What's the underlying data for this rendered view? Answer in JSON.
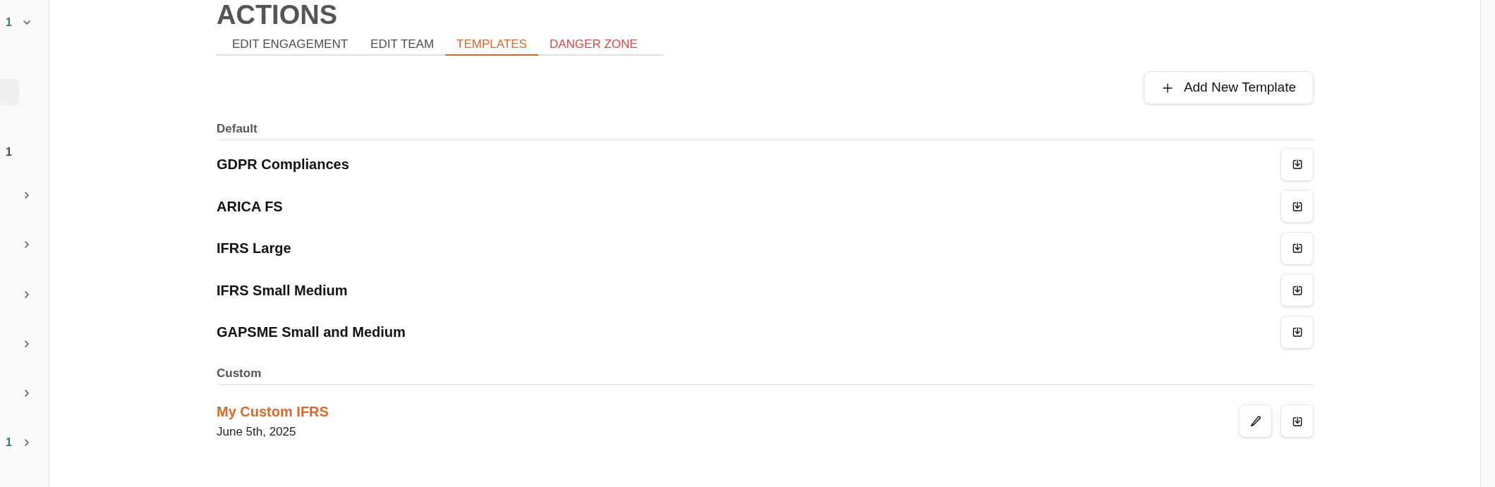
{
  "sidebar": {
    "items": [
      {
        "count": "1",
        "color": "#2b7b78",
        "expanded": true,
        "selected": false
      },
      {
        "selected": true
      },
      {
        "count": "1",
        "color": "#4a4a4a",
        "selected": false
      },
      {
        "expanded": false,
        "selected": false
      },
      {
        "expanded": false,
        "selected": false
      },
      {
        "expanded": false,
        "selected": false
      },
      {
        "expanded": false,
        "selected": false
      },
      {
        "expanded": false,
        "selected": false
      },
      {
        "count": "1",
        "color": "#2b7b78",
        "expanded": false,
        "selected": false
      }
    ]
  },
  "title": "ACTIONS",
  "tabs": [
    {
      "label": "EDIT ENGAGEMENT",
      "kind": "normal",
      "selected": false
    },
    {
      "label": "EDIT TEAM",
      "kind": "normal",
      "selected": false
    },
    {
      "label": "TEMPLATES",
      "kind": "normal",
      "selected": true
    },
    {
      "label": "DANGER ZONE",
      "kind": "danger",
      "selected": false
    }
  ],
  "add_button": {
    "label": "Add New Template"
  },
  "sections": [
    {
      "heading": "Default",
      "templates": [
        {
          "name": "GDPR Compliances",
          "kind": "default",
          "actions": [
            {
              "kind": "download"
            }
          ]
        },
        {
          "name": "ARICA FS",
          "kind": "default",
          "actions": [
            {
              "kind": "download"
            }
          ]
        },
        {
          "name": "IFRS Large",
          "kind": "default",
          "actions": [
            {
              "kind": "download"
            }
          ]
        },
        {
          "name": "IFRS Small Medium",
          "kind": "default",
          "actions": [
            {
              "kind": "download"
            }
          ]
        },
        {
          "name": "GAPSME Small and Medium",
          "kind": "default",
          "actions": [
            {
              "kind": "download"
            }
          ]
        }
      ]
    },
    {
      "heading": "Custom",
      "templates": [
        {
          "name": "My Custom IFRS",
          "kind": "custom",
          "date": "June 5th, 2025",
          "actions": [
            {
              "kind": "edit"
            },
            {
              "kind": "download"
            }
          ]
        }
      ]
    }
  ]
}
